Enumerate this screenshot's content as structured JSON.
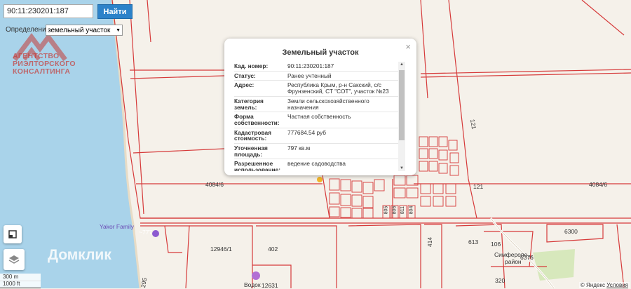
{
  "search": {
    "value": "90:11:230201:187",
    "button_label": "Найти"
  },
  "definition": {
    "label": "Определение",
    "selected": "земельный участок"
  },
  "logo": {
    "line1": "АГЕНТСТВО",
    "line2": "РИЭЛТОРСКОГО",
    "line3": "КОНСАЛТИНГА"
  },
  "watermark": "Домклик",
  "map_labels": {
    "l_4084_left": "4084/6",
    "l_4084_right": "4084/6",
    "l_121a": "121",
    "l_121b": "121",
    "l_12946": "12946/1",
    "l_402": "402",
    "l_414": "414",
    "l_613": "613",
    "l_106": "106",
    "l_6300": "6300",
    "l_6376": "6376",
    "l_320": "320",
    "l_12631": "12631",
    "l_777": "~777",
    "l_805": "805",
    "l_806": "806",
    "l_811": "811",
    "l_804": "804",
    "yakor": "Yakor Family",
    "simf": "Симферопо...",
    "raion": "район",
    "vodok": "Водок",
    "l_295": "295"
  },
  "popup": {
    "title": "Земельный участок",
    "close": "×",
    "rows": [
      {
        "k": "Кад. номер:",
        "v": "90:11:230201:187"
      },
      {
        "k": "Статус:",
        "v": "Ранее учтенный"
      },
      {
        "k": "Адрес:",
        "v": "Республика Крым, р-н Сакский, с/с Фрунзенский, СТ \"СОТ\", участок №23"
      },
      {
        "k": "Категория земель:",
        "v": "Земли сельскохозяйственного назначения"
      },
      {
        "k": "Форма собственности:",
        "v": "Частная собственность"
      },
      {
        "k": "Кадастровая стоимость:",
        "v": "777684.54 руб"
      },
      {
        "k": "Уточненная площадь:",
        "v": "797 кв.м"
      },
      {
        "k": "Разрешенное использование:",
        "v": "ведение садоводства"
      }
    ]
  },
  "scale": {
    "metric": "300 m",
    "imperial": "1000 ft"
  },
  "copyright": {
    "text": "© Яндекс",
    "link": "Условия"
  },
  "colors": {
    "sea": "#a9d3ea",
    "land": "#f5f1ea",
    "parcel": "#d63a3a",
    "button": "#2c82c9"
  }
}
